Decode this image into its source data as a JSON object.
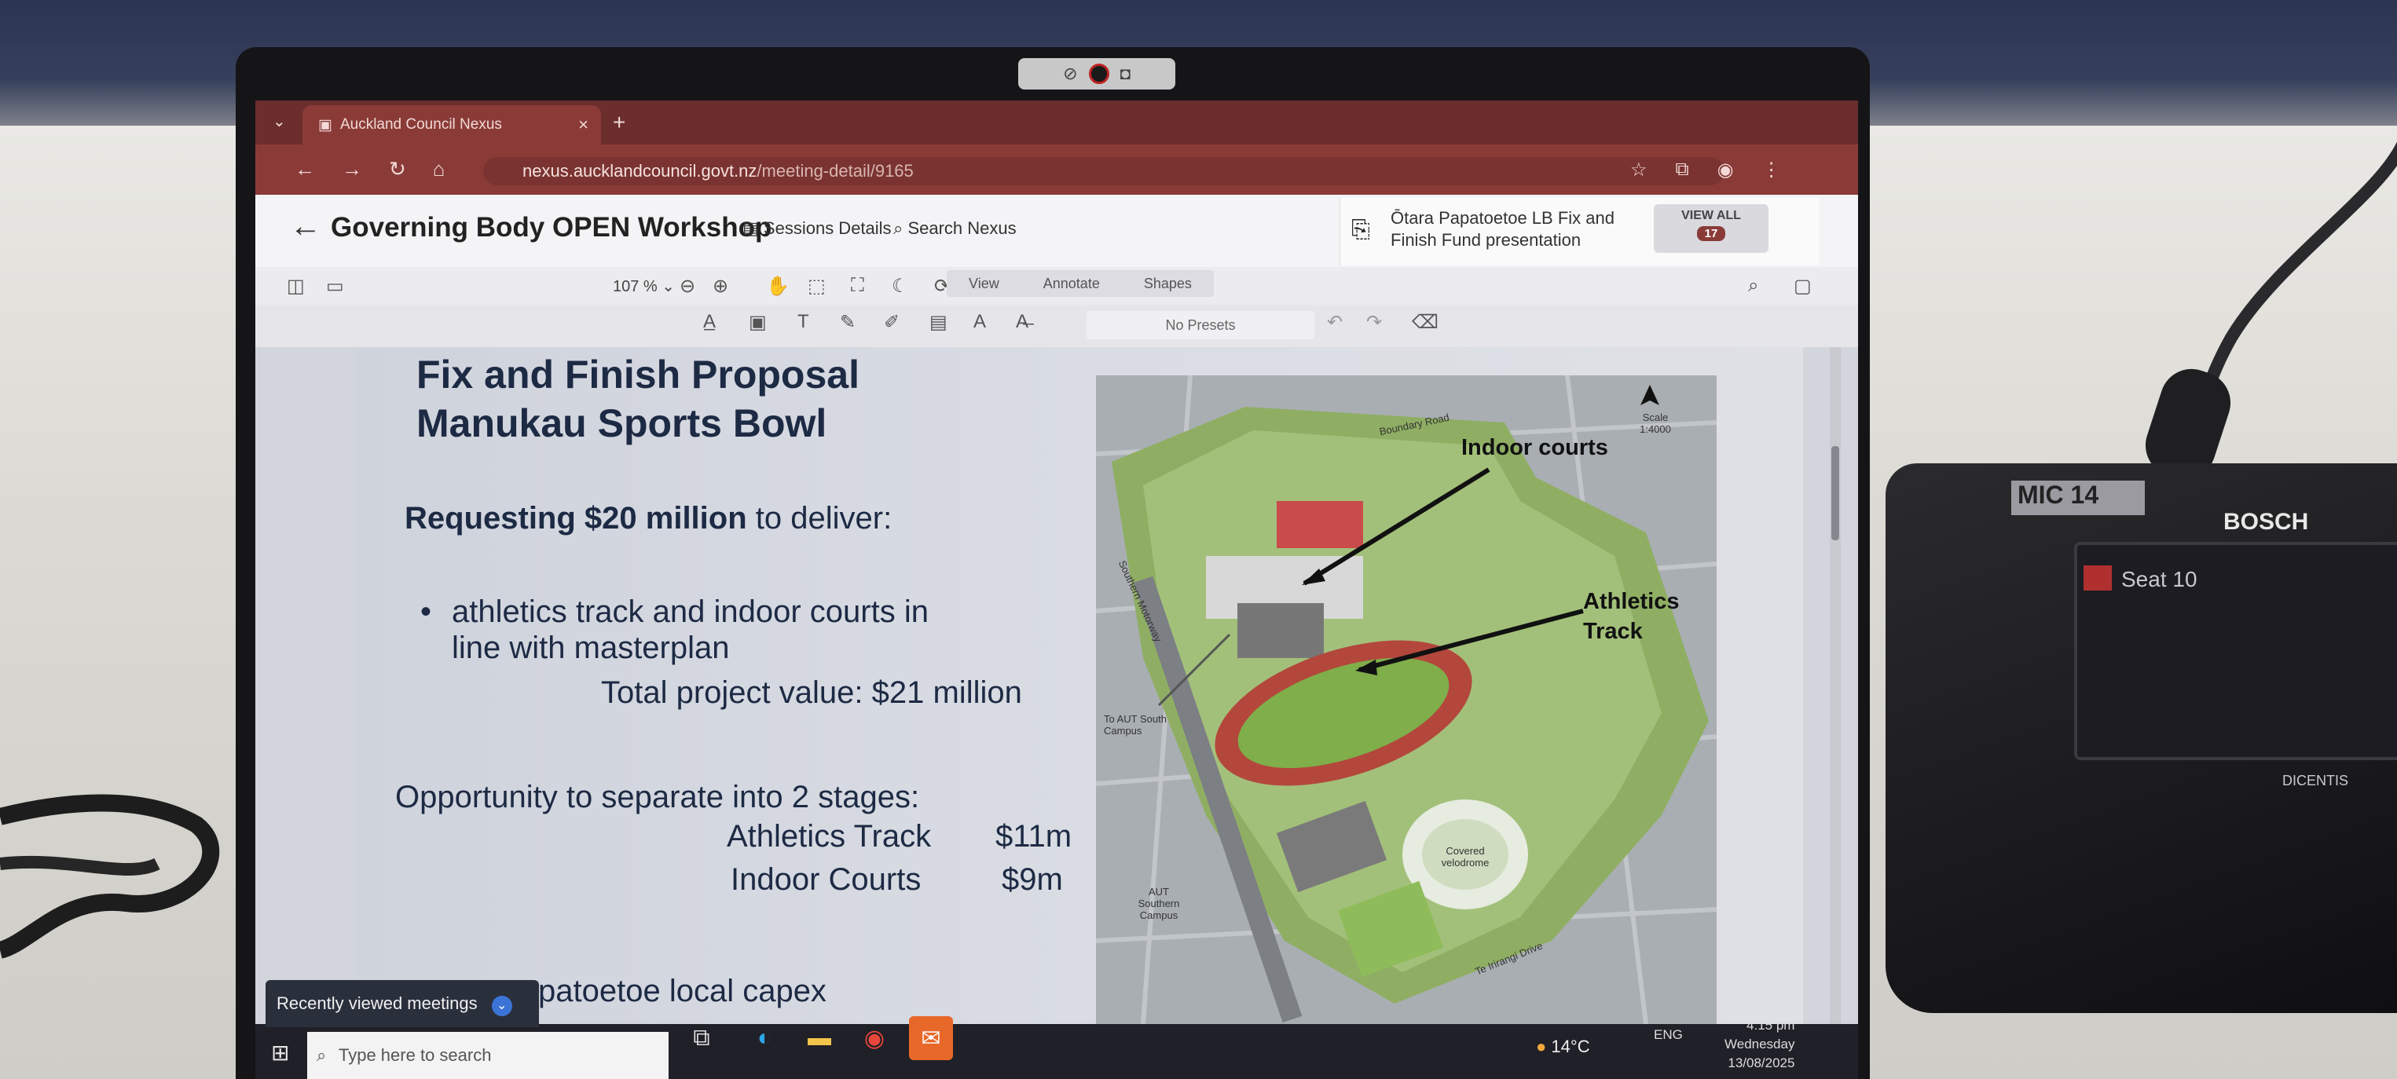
{
  "browser": {
    "tab_title": "Auckland Council Nexus",
    "tab_close": "×",
    "new_tab": "+",
    "url_host": "nexus.aucklandcouncil.govt.nz",
    "url_path": "/meeting-detail/9165"
  },
  "app": {
    "back": "←",
    "title": "Governing Body OPEN Workshop",
    "sessions_label": "Sessions Details",
    "search_label": "Search Nexus",
    "document_title": "Ōtara Papatoetoe LB Fix and Finish Fund presentation",
    "view_all_label": "VIEW ALL",
    "view_all_count": "17"
  },
  "viewer": {
    "zoom": "107 %",
    "modes": [
      "View",
      "Annotate",
      "Shapes"
    ],
    "presets_label": "No Presets"
  },
  "slide": {
    "title_line1": "Fix and Finish Proposal",
    "title_line2": "Manukau Sports Bowl",
    "request_bold": "Requesting $20 million",
    "request_rest": " to deliver:",
    "bullet_line1": "athletics track and indoor courts in",
    "bullet_line2": "line with masterplan",
    "total": "Total project value: $21 million",
    "opportunity": "Opportunity to separate into 2 stages:",
    "stages": [
      {
        "name": "Athletics Track",
        "value": "$11m"
      },
      {
        "name": "Indoor Courts",
        "value": "$9m"
      }
    ],
    "local_capex_partial": "patoetoe local capex"
  },
  "map": {
    "label_indoor": "Indoor courts",
    "label_athletics_1": "Athletics",
    "label_athletics_2": "Track",
    "road_boundary": "Boundary Road",
    "road_southern": "Southern Motorway",
    "road_te_irirangi": "Te Irirangi Drive",
    "aut_south": "To AUT South Campus",
    "aut_southern": "AUT Southern Campus",
    "covered_velodrome": "Covered velodrome",
    "scale": "Scale 1:4000"
  },
  "recent": {
    "label": "Recently viewed meetings",
    "chevron": "⌄"
  },
  "taskbar": {
    "search_placeholder": "Type here to search",
    "temperature": "14°C",
    "language": "ENG",
    "time": "4:15 pm",
    "day": "Wednesday",
    "date": "13/08/2025"
  },
  "mic": {
    "label": "MIC 14",
    "brand": "BOSCH",
    "seat": "Seat 10",
    "sub_brand": "DICENTIS"
  }
}
